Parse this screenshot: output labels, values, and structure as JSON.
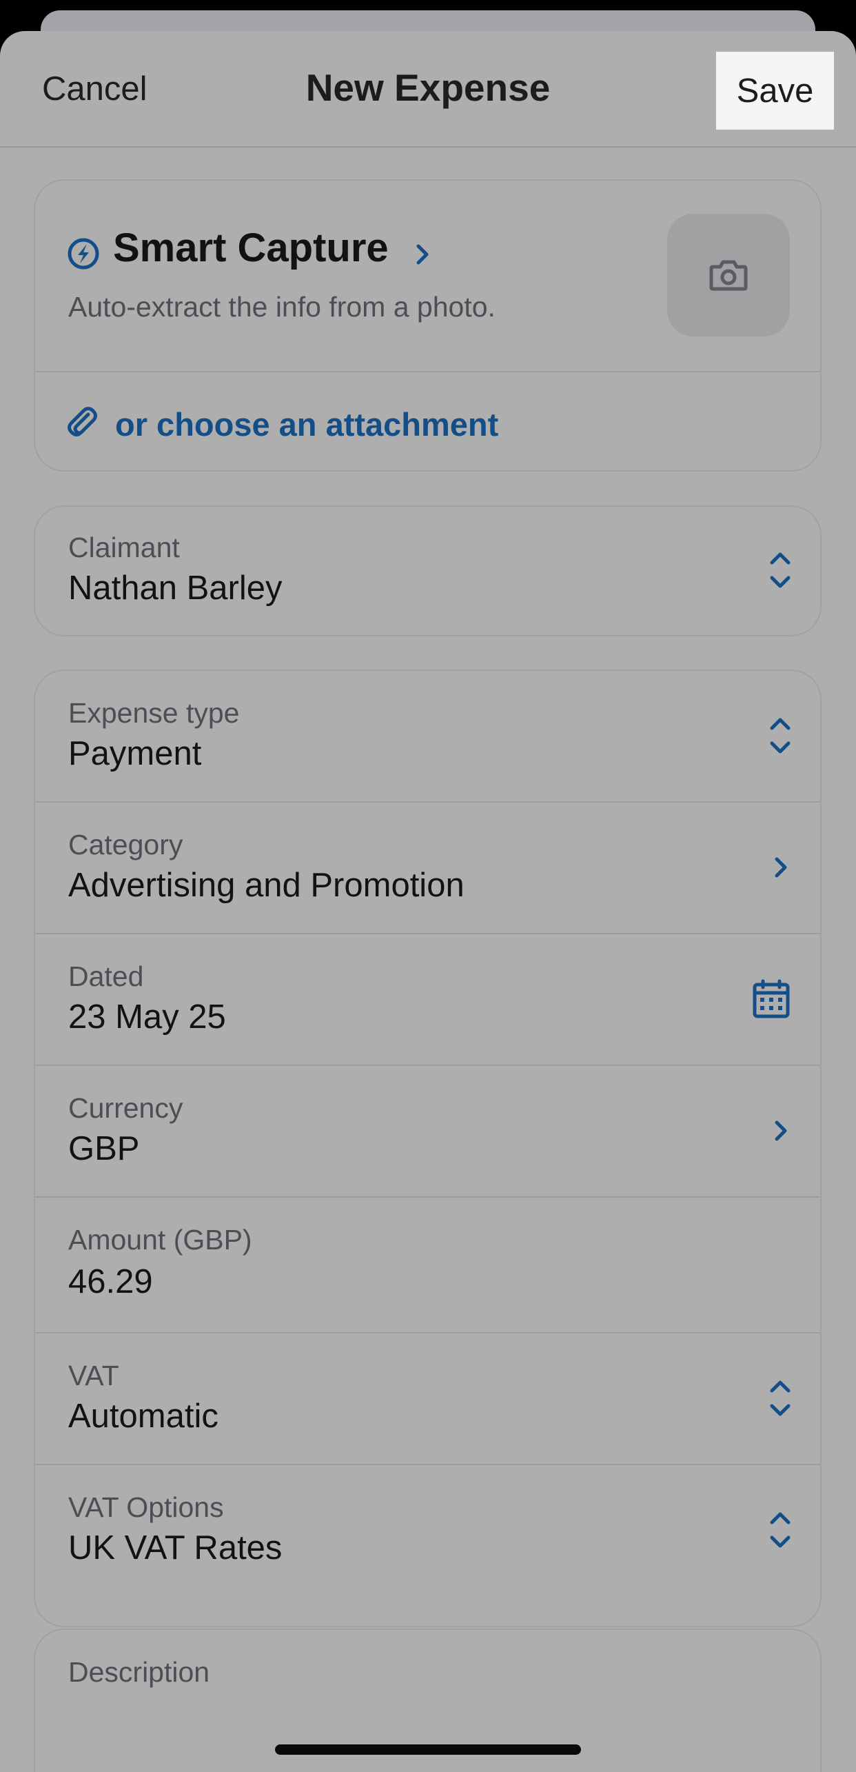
{
  "navbar": {
    "cancel_label": "Cancel",
    "title": "New Expense",
    "save_label": "Save"
  },
  "smart_capture": {
    "title": "Smart Capture",
    "subtitle": "Auto-extract the info from a photo.",
    "attachment_label": "or choose an attachment"
  },
  "claimant": {
    "label": "Claimant",
    "value": "Nathan Barley"
  },
  "fields": {
    "expense_type": {
      "label": "Expense type",
      "value": "Payment"
    },
    "category": {
      "label": "Category",
      "value": "Advertising and Promotion"
    },
    "dated": {
      "label": "Dated",
      "value": "23 May 25"
    },
    "currency": {
      "label": "Currency",
      "value": "GBP"
    },
    "amount": {
      "label": "Amount (GBP)",
      "value": "46.29"
    },
    "vat": {
      "label": "VAT",
      "value": "Automatic"
    },
    "vat_options": {
      "label": "VAT Options",
      "value": "UK VAT Rates"
    }
  },
  "description": {
    "label": "Description"
  },
  "colors": {
    "accent": "#144e88",
    "overlay_background": "#aeaeae",
    "save_highlight": "#f4f5f7"
  },
  "icons": [
    "smart-capture-bolt-icon",
    "chevron-right-icon",
    "camera-icon",
    "paperclip-icon",
    "up-down-chevron-icon",
    "calendar-icon"
  ]
}
